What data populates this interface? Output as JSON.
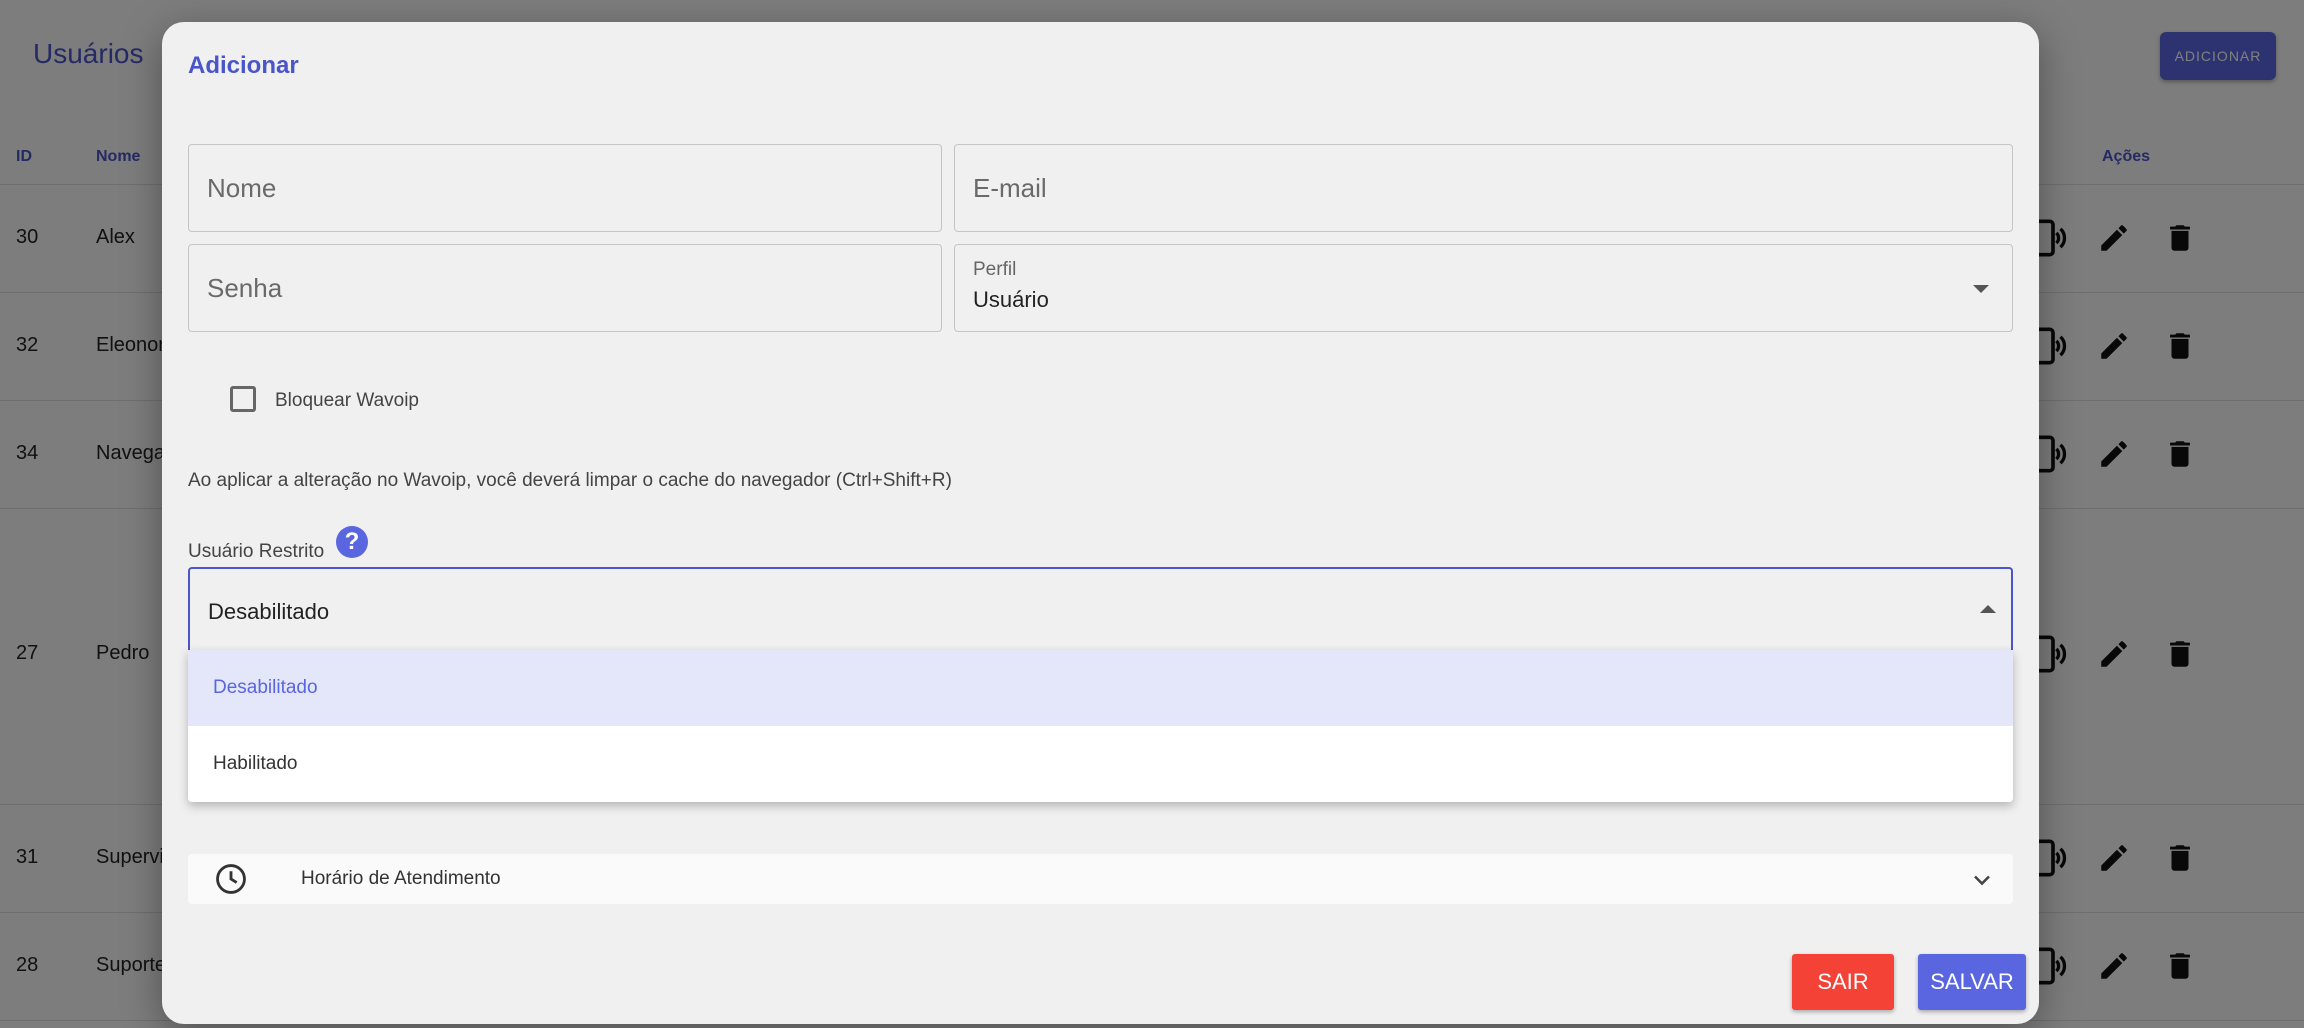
{
  "background": {
    "title": "Usuários",
    "add_button": "ADICIONAR",
    "table": {
      "headers": {
        "id": "ID",
        "name": "Nome",
        "actions": "Ações"
      },
      "rows": [
        {
          "id": "30",
          "name": "Alex"
        },
        {
          "id": "32",
          "name": "Eleonor"
        },
        {
          "id": "34",
          "name": "Navega"
        },
        {
          "id": "27",
          "name": "Pedro"
        },
        {
          "id": "31",
          "name": "Supervi"
        },
        {
          "id": "28",
          "name": "Suporte"
        }
      ],
      "action_icons": [
        "phone-call-icon",
        "edit-icon",
        "delete-icon"
      ]
    }
  },
  "modal": {
    "title": "Adicionar",
    "fields": {
      "name_placeholder": "Nome",
      "email_placeholder": "E-mail",
      "password_placeholder": "Senha",
      "profile_label": "Perfil",
      "profile_value": "Usuário"
    },
    "block_wavoip_label": "Bloquear Wavoip",
    "block_wavoip_checked": false,
    "wavoip_hint": "Ao aplicar a alteração no Wavoip, você deverá limpar o cache do navegador (Ctrl+Shift+R)",
    "restricted_user": {
      "label": "Usuário Restrito",
      "value": "Desabilitado",
      "options": [
        "Desabilitado",
        "Habilitado"
      ]
    },
    "schedule_label": "Horário de Atendimento",
    "exit_button": "SAIR",
    "save_button": "SALVAR"
  },
  "colors": {
    "primary": "#5a66e0",
    "title": "#4a55c8",
    "danger": "#f44336",
    "overlay": "rgba(0,0,0,0.5)",
    "option_selected_bg": "#e4e6fa"
  }
}
